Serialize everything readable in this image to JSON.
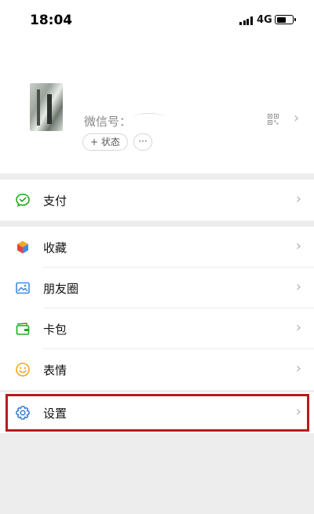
{
  "status_bar": {
    "time": "18:04",
    "network": "4G",
    "battery_level_percent": 55
  },
  "profile": {
    "wechat_id_label": "微信号：",
    "status_button_label": "+ 状态",
    "more_button_label": "···",
    "icons": {
      "qr": "qr-code-icon",
      "chevron": "chevron-right-icon"
    }
  },
  "menu": {
    "pay": {
      "label": "支付",
      "icon": "pay-icon",
      "icon_color": "#1aad19"
    },
    "favorites": {
      "label": "收藏",
      "icon": "favorites-cube-icon"
    },
    "moments": {
      "label": "朋友圈",
      "icon": "moments-image-icon",
      "icon_color": "#3a8ee6"
    },
    "cards": {
      "label": "卡包",
      "icon": "card-wallet-icon",
      "icon_color": "#1aad19"
    },
    "stickers": {
      "label": "表情",
      "icon": "sticker-smiley-icon",
      "icon_color": "#f5a623"
    },
    "settings": {
      "label": "设置",
      "icon": "gear-icon",
      "icon_color": "#3a7bd5"
    }
  },
  "highlight_color": "#b81b1b"
}
